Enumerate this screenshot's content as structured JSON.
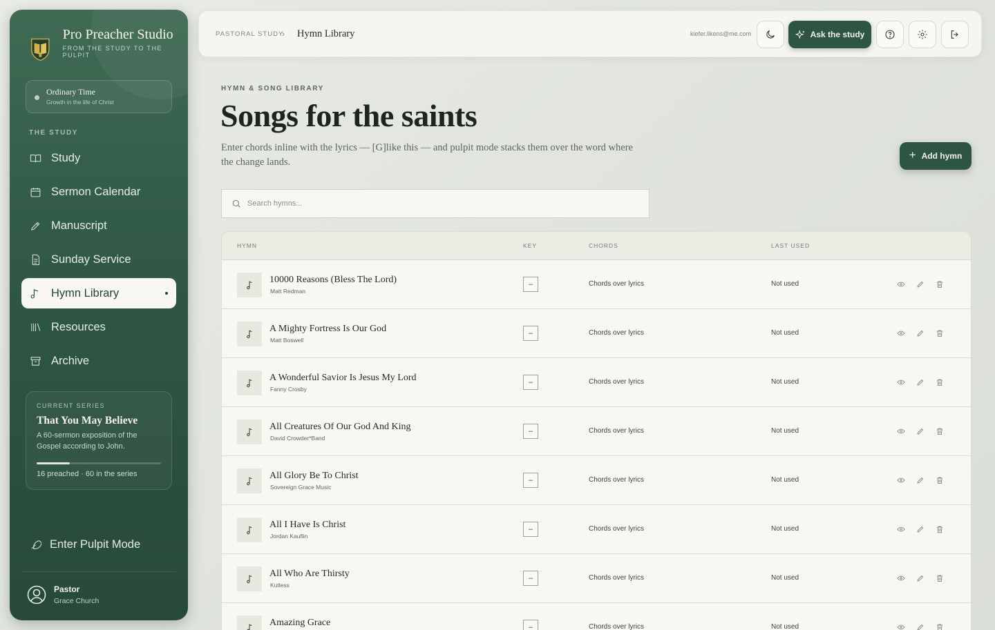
{
  "brand": {
    "name": "Pro Preacher Studio",
    "tagline": "FROM THE STUDY TO THE PULPIT"
  },
  "season": {
    "title": "Ordinary Time",
    "subtitle": "Growth in the life of Christ"
  },
  "sidebar": {
    "section_label": "THE STUDY",
    "items": [
      {
        "label": "Study",
        "icon": "book-open-icon"
      },
      {
        "label": "Sermon Calendar",
        "icon": "calendar-icon"
      },
      {
        "label": "Manuscript",
        "icon": "pen-icon"
      },
      {
        "label": "Sunday Service",
        "icon": "document-icon"
      },
      {
        "label": "Hymn Library",
        "icon": "music-note-icon",
        "active": true
      },
      {
        "label": "Resources",
        "icon": "library-icon"
      },
      {
        "label": "Archive",
        "icon": "archive-icon"
      }
    ],
    "pulpit_label": "Enter Pulpit Mode"
  },
  "series": {
    "label": "CURRENT SERIES",
    "title": "That You May Believe",
    "description": "A 60-sermon exposition of the Gospel according to John.",
    "progress": 0.267,
    "count_text": "16 preached · 60 in the series"
  },
  "user": {
    "role": "Pastor",
    "church": "Grace Church",
    "email": "kiefer.likens@me.com"
  },
  "topbar": {
    "breadcrumb_root": "PASTORAL STUDY",
    "breadcrumb_sep": "›",
    "breadcrumb_current": "Hymn Library",
    "ask_label": "Ask the study"
  },
  "page": {
    "eyebrow": "HYMN & SONG LIBRARY",
    "title": "Songs for the saints",
    "description": "Enter chords inline with the lyrics — [G]like this — and pulpit mode stacks them over the word where the change lands.",
    "add_label": "Add hymn",
    "add_plus": "+"
  },
  "search": {
    "placeholder": "Search hymns...",
    "value": ""
  },
  "table": {
    "columns": {
      "hymn": "HYMN",
      "key": "KEY",
      "chords": "CHORDS",
      "last_used": "LAST USED"
    },
    "rows": [
      {
        "title": "10000 Reasons (Bless The Lord)",
        "author": "Matt Redman",
        "key": "–",
        "chords": "Chords over lyrics",
        "last_used": "Not used"
      },
      {
        "title": "A Mighty Fortress Is Our God",
        "author": "Matt Boswell",
        "key": "–",
        "chords": "Chords over lyrics",
        "last_used": "Not used"
      },
      {
        "title": "A Wonderful Savior Is Jesus My Lord",
        "author": "Fanny Crosby",
        "key": "–",
        "chords": "Chords over lyrics",
        "last_used": "Not used"
      },
      {
        "title": "All Creatures Of Our God And King",
        "author": "David Crowder*Band",
        "key": "–",
        "chords": "Chords over lyrics",
        "last_used": "Not used"
      },
      {
        "title": "All Glory Be To Christ",
        "author": "Sovereign Grace Music",
        "key": "–",
        "chords": "Chords over lyrics",
        "last_used": "Not used"
      },
      {
        "title": "All I Have Is Christ",
        "author": "Jordan Kauflin",
        "key": "–",
        "chords": "Chords over lyrics",
        "last_used": "Not used"
      },
      {
        "title": "All Who Are Thirsty",
        "author": "Kutless",
        "key": "–",
        "chords": "Chords over lyrics",
        "last_used": "Not used"
      },
      {
        "title": "Amazing Grace",
        "author": "",
        "key": "–",
        "chords": "Chords over lyrics",
        "last_used": "Not used"
      }
    ]
  },
  "colors": {
    "sidebar_green": "#2f5744",
    "accent_green": "#2e5442",
    "page_bg": "#e5e8e2",
    "card_bg": "#f8f7f2"
  }
}
